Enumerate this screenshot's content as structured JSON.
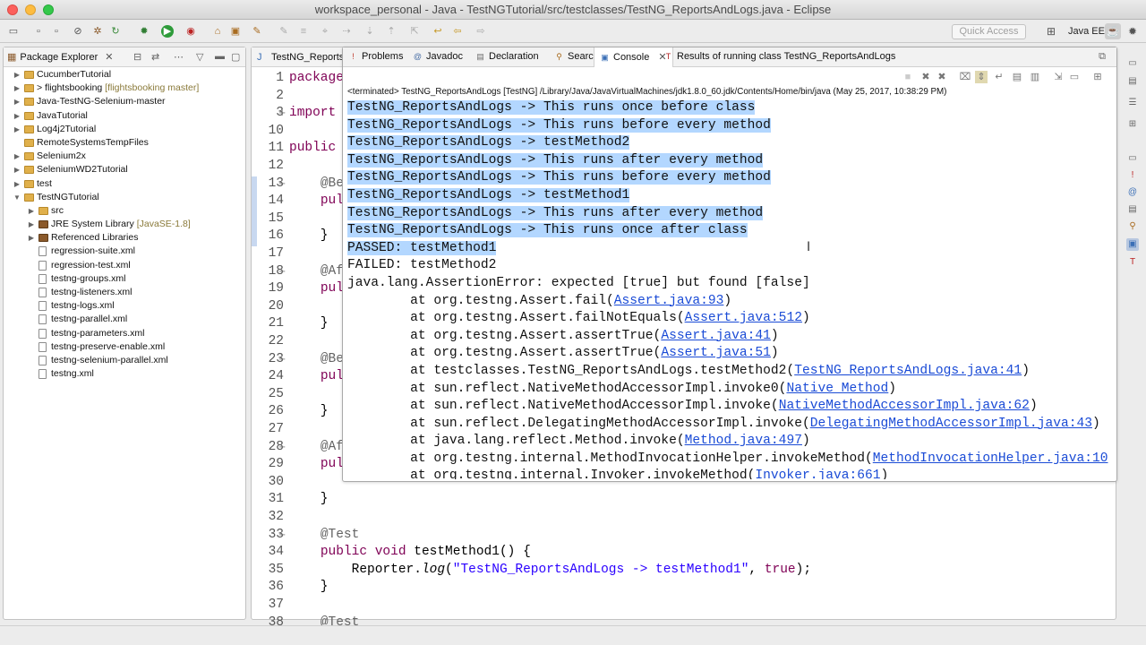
{
  "window": {
    "title": "workspace_personal - Java - TestNGTutorial/src/testclasses/TestNG_ReportsAndLogs.java - Eclipse"
  },
  "toolbar": {
    "quick_access_placeholder": "Quick Access",
    "perspective": "Java EE"
  },
  "package_explorer": {
    "title": "Package Explorer",
    "items": [
      {
        "label": "CucumberTutorial",
        "suffix": "",
        "indent": 0,
        "kind": "project",
        "arrow": "▶"
      },
      {
        "label": "> flightsbooking",
        "suffix": " [flightsbooking master]",
        "indent": 0,
        "kind": "project",
        "arrow": "▶"
      },
      {
        "label": "Java-TestNG-Selenium-master",
        "suffix": "",
        "indent": 0,
        "kind": "project",
        "arrow": "▶"
      },
      {
        "label": "JavaTutorial",
        "suffix": "",
        "indent": 0,
        "kind": "project",
        "arrow": "▶"
      },
      {
        "label": "Log4j2Tutorial",
        "suffix": "",
        "indent": 0,
        "kind": "project",
        "arrow": "▶"
      },
      {
        "label": "RemoteSystemsTempFiles",
        "suffix": "",
        "indent": 0,
        "kind": "project",
        "arrow": ""
      },
      {
        "label": "Selenium2x",
        "suffix": "",
        "indent": 0,
        "kind": "project",
        "arrow": "▶"
      },
      {
        "label": "SeleniumWD2Tutorial",
        "suffix": "",
        "indent": 0,
        "kind": "project",
        "arrow": "▶"
      },
      {
        "label": "test",
        "suffix": "",
        "indent": 0,
        "kind": "project",
        "arrow": "▶"
      },
      {
        "label": "TestNGTutorial",
        "suffix": "",
        "indent": 0,
        "kind": "project",
        "arrow": "▼"
      },
      {
        "label": "src",
        "suffix": "",
        "indent": 1,
        "kind": "folder",
        "arrow": "▶"
      },
      {
        "label": "JRE System Library",
        "suffix": " [JavaSE-1.8]",
        "indent": 1,
        "kind": "lib",
        "arrow": "▶"
      },
      {
        "label": "Referenced Libraries",
        "suffix": "",
        "indent": 1,
        "kind": "lib",
        "arrow": "▶"
      },
      {
        "label": "regression-suite.xml",
        "suffix": "",
        "indent": 1,
        "kind": "xml",
        "arrow": ""
      },
      {
        "label": "regression-test.xml",
        "suffix": "",
        "indent": 1,
        "kind": "xml",
        "arrow": ""
      },
      {
        "label": "testng-groups.xml",
        "suffix": "",
        "indent": 1,
        "kind": "xml",
        "arrow": ""
      },
      {
        "label": "testng-listeners.xml",
        "suffix": "",
        "indent": 1,
        "kind": "xml",
        "arrow": ""
      },
      {
        "label": "testng-logs.xml",
        "suffix": "",
        "indent": 1,
        "kind": "xml",
        "arrow": ""
      },
      {
        "label": "testng-parallel.xml",
        "suffix": "",
        "indent": 1,
        "kind": "xml",
        "arrow": ""
      },
      {
        "label": "testng-parameters.xml",
        "suffix": "",
        "indent": 1,
        "kind": "xml",
        "arrow": ""
      },
      {
        "label": "testng-preserve-enable.xml",
        "suffix": "",
        "indent": 1,
        "kind": "xml",
        "arrow": ""
      },
      {
        "label": "testng-selenium-parallel.xml",
        "suffix": "",
        "indent": 1,
        "kind": "xml",
        "arrow": ""
      },
      {
        "label": "testng.xml",
        "suffix": "",
        "indent": 1,
        "kind": "xml",
        "arrow": ""
      }
    ]
  },
  "editor": {
    "tab": "TestNG_Reports",
    "lines": [
      {
        "n": "1",
        "html": "<span class=\"kwp\">package</span>"
      },
      {
        "n": "2",
        "html": ""
      },
      {
        "n": "3",
        "fold": "+",
        "html": "<span class=\"kwp\">import</span>"
      },
      {
        "n": "10",
        "html": ""
      },
      {
        "n": "11",
        "html": "<span class=\"kwp\">public</span>"
      },
      {
        "n": "12",
        "html": ""
      },
      {
        "n": "13",
        "fold": "−",
        "html": "    <span class=\"ann\">@Be</span>"
      },
      {
        "n": "14",
        "html": "    <span class=\"kwp\">pul</span>"
      },
      {
        "n": "15",
        "html": ""
      },
      {
        "n": "16",
        "html": "    }"
      },
      {
        "n": "17",
        "html": ""
      },
      {
        "n": "18",
        "fold": "−",
        "html": "    <span class=\"ann\">@Af</span>"
      },
      {
        "n": "19",
        "html": "    <span class=\"kwp\">pul</span>"
      },
      {
        "n": "20",
        "html": ""
      },
      {
        "n": "21",
        "html": "    }"
      },
      {
        "n": "22",
        "html": ""
      },
      {
        "n": "23",
        "fold": "−",
        "html": "    <span class=\"ann\">@Be</span>"
      },
      {
        "n": "24",
        "html": "    <span class=\"kwp\">pul</span>"
      },
      {
        "n": "25",
        "html": ""
      },
      {
        "n": "26",
        "html": "    }"
      },
      {
        "n": "27",
        "html": ""
      },
      {
        "n": "28",
        "fold": "−",
        "html": "    <span class=\"ann\">@Af</span>"
      },
      {
        "n": "29",
        "html": "    <span class=\"kwp\">pul</span>"
      },
      {
        "n": "30",
        "html": ""
      },
      {
        "n": "31",
        "html": "    }"
      },
      {
        "n": "32",
        "html": ""
      },
      {
        "n": "33",
        "fold": "−",
        "html": "    <span class=\"ann\">@Test</span>"
      },
      {
        "n": "34",
        "html": "    <span class=\"kwp\">public</span> <span class=\"kwp\">void</span> testMethod1() {"
      },
      {
        "n": "35",
        "html": "        Reporter.<i>log</i>(<span class=\"str\">\"TestNG_ReportsAndLogs -&gt; testMethod1\"</span>, <span class=\"kwp\">true</span>);"
      },
      {
        "n": "36",
        "html": "    }"
      },
      {
        "n": "37",
        "html": ""
      },
      {
        "n": "38",
        "html": "    <span class=\"ann\">@Test</span>"
      }
    ]
  },
  "console": {
    "tabs": [
      {
        "label": "Problems",
        "icon": "problems-icon",
        "glyph": "!",
        "color": "#c0392b"
      },
      {
        "label": "Javadoc",
        "icon": "javadoc-icon",
        "glyph": "@",
        "color": "#4a6fa5"
      },
      {
        "label": "Declaration",
        "icon": "declaration-icon",
        "glyph": "▤",
        "color": "#6d6d6d"
      },
      {
        "label": "Search",
        "icon": "search-icon",
        "glyph": "⚲",
        "color": "#a86b1f"
      },
      {
        "label": "Console",
        "icon": "console-icon",
        "glyph": "▣",
        "color": "#3b6fb6"
      },
      {
        "label": "Results of running class TestNG_ReportsAndLogs",
        "icon": "testng-icon",
        "glyph": "T",
        "color": "#b22222"
      }
    ],
    "terminated": "<terminated> TestNG_ReportsAndLogs [TestNG] /Library/Java/JavaVirtualMachines/jdk1.8.0_60.jdk/Contents/Home/bin/java (May 25, 2017, 10:38:29 PM)",
    "lines": [
      {
        "text": "TestNG_ReportsAndLogs -> This runs once before class",
        "sel": true
      },
      {
        "text": "TestNG_ReportsAndLogs -> This runs before every method",
        "sel": true
      },
      {
        "text": "TestNG_ReportsAndLogs -> testMethod2",
        "sel": true
      },
      {
        "text": "TestNG_ReportsAndLogs -> This runs after every method",
        "sel": true
      },
      {
        "text": "TestNG_ReportsAndLogs -> This runs before every method",
        "sel": true
      },
      {
        "text": "TestNG_ReportsAndLogs -> testMethod1",
        "sel": true
      },
      {
        "text": "TestNG_ReportsAndLogs -> This runs after every method",
        "sel": true
      },
      {
        "text": "TestNG_ReportsAndLogs -> This runs once after class",
        "sel": true
      },
      {
        "text": "PASSED: testMethod1",
        "sel": true
      },
      {
        "text": "FAILED: testMethod2",
        "sel": false
      },
      {
        "text": "java.lang.AssertionError: expected [true] but found [false]",
        "sel": false
      },
      {
        "pre": "\tat org.testng.Assert.fail(",
        "link": "Assert.java:93",
        "post": ")"
      },
      {
        "pre": "\tat org.testng.Assert.failNotEquals(",
        "link": "Assert.java:512",
        "post": ")"
      },
      {
        "pre": "\tat org.testng.Assert.assertTrue(",
        "link": "Assert.java:41",
        "post": ")"
      },
      {
        "pre": "\tat org.testng.Assert.assertTrue(",
        "link": "Assert.java:51",
        "post": ")"
      },
      {
        "pre": "\tat testclasses.TestNG_ReportsAndLogs.testMethod2(",
        "link": "TestNG_ReportsAndLogs.java:41",
        "post": ")"
      },
      {
        "pre": "\tat sun.reflect.NativeMethodAccessorImpl.invoke0(",
        "link": "Native Method",
        "post": ")"
      },
      {
        "pre": "\tat sun.reflect.NativeMethodAccessorImpl.invoke(",
        "link": "NativeMethodAccessorImpl.java:62",
        "post": ")"
      },
      {
        "pre": "\tat sun.reflect.DelegatingMethodAccessorImpl.invoke(",
        "link": "DelegatingMethodAccessorImpl.java:43",
        "post": ")"
      },
      {
        "pre": "\tat java.lang.reflect.Method.invoke(",
        "link": "Method.java:497",
        "post": ")"
      },
      {
        "pre": "\tat org.testng.internal.MethodInvocationHelper.invokeMethod(",
        "link": "MethodInvocationHelper.java:10",
        "post": ""
      },
      {
        "pre": "\tat org.testng.internal.Invoker.invokeMethod(",
        "link": "Invoker.java:661",
        "post": ")"
      }
    ]
  }
}
